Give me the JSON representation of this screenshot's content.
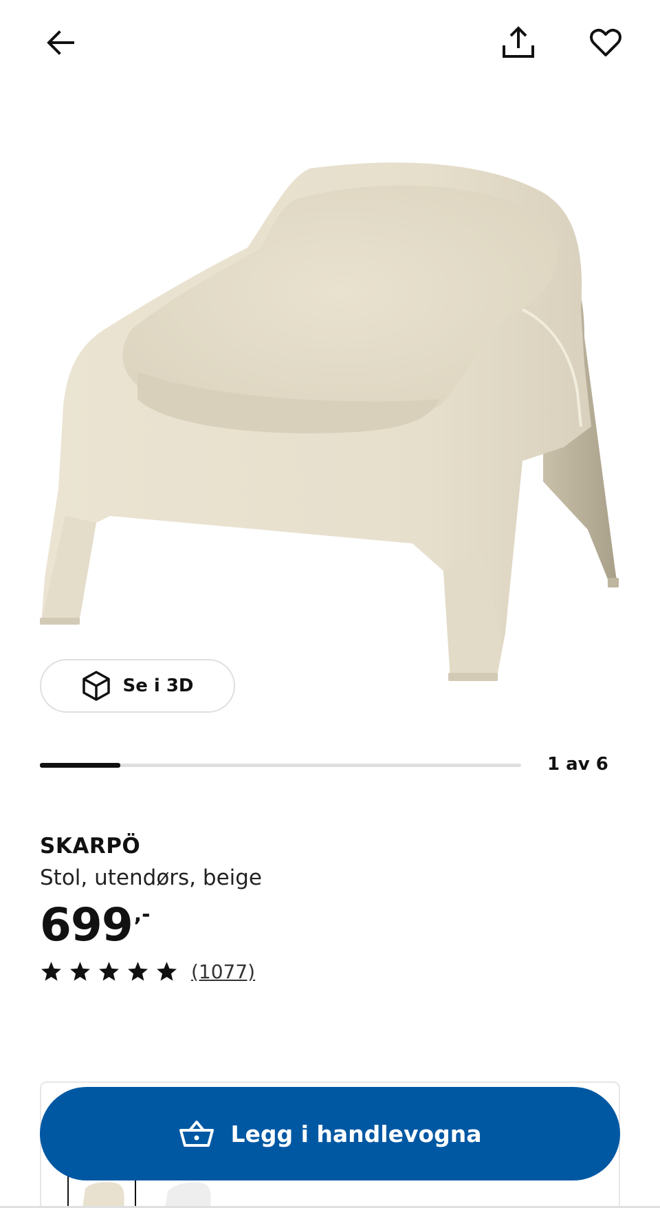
{
  "header": {
    "back_icon": "arrow-left-icon",
    "share_icon": "share-icon",
    "favourite_icon": "heart-icon"
  },
  "gallery": {
    "view_3d_label": "Se i 3D",
    "view_3d_icon": "cube-icon",
    "slide_counter": "1 av 6",
    "current_slide": 1,
    "total_slides": 6
  },
  "product": {
    "name": "SKARPÖ",
    "description": "Stol, utendørs, beige",
    "price": "699",
    "price_suffix": ",-",
    "rating": 5,
    "review_count": "(1077)",
    "color": "#ece6d5"
  },
  "cart": {
    "button_label": "Legg i handlevogna",
    "button_icon": "basket-icon",
    "button_color": "#0058a3"
  }
}
